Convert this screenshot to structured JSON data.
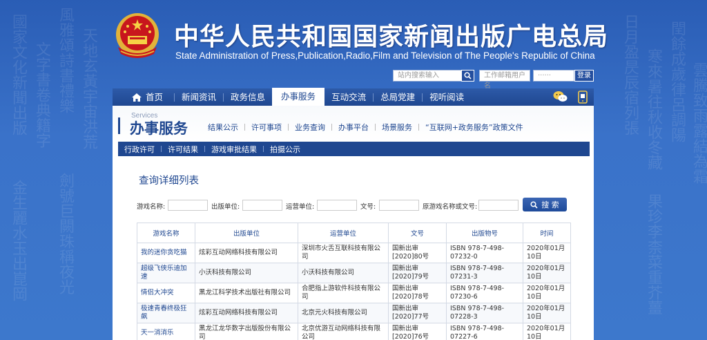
{
  "header": {
    "title_cn": "中华人民共和国国家新闻出版广电总局",
    "title_en": "State Administration of Press,Publication,Radio,Film and Television of The People's Republic of China",
    "search_placeholder": "站内搜索输入",
    "mail_placeholder": "工作邮箱用户名",
    "password_mask": "······",
    "login_label": "登录"
  },
  "nav": {
    "items": [
      {
        "label": "首页"
      },
      {
        "label": "新闻资讯"
      },
      {
        "label": "政务信息"
      },
      {
        "label": "办事服务"
      },
      {
        "label": "互动交流"
      },
      {
        "label": "总局党建"
      },
      {
        "label": "视听阅读"
      }
    ],
    "active": "办事服务"
  },
  "section": {
    "title_en": "Services",
    "title_cn": "办事服务",
    "links": [
      {
        "label": "结果公示"
      },
      {
        "label": "许可事项"
      },
      {
        "label": "业务查询"
      },
      {
        "label": "办事平台"
      },
      {
        "label": "场景服务"
      },
      {
        "label": "“互联网+政务服务”政策文件"
      }
    ],
    "subnav": [
      {
        "label": "行政许可"
      },
      {
        "label": "许可结果"
      },
      {
        "label": "游戏审批结果"
      },
      {
        "label": "拍摄公示"
      }
    ]
  },
  "query": {
    "title": "查询详细列表",
    "filters": [
      {
        "label": "游戏名称:"
      },
      {
        "label": "出版单位:"
      },
      {
        "label": "运营单位:"
      },
      {
        "label": "文号:"
      },
      {
        "label": "原游戏名称或文号:"
      }
    ],
    "search_button": "搜 索"
  },
  "table": {
    "headers": [
      "游戏名称",
      "出版单位",
      "运营单位",
      "文号",
      "出版物号",
      "时间"
    ],
    "rows": [
      [
        "我的迷你贪吃猫",
        "炫彩互动网络科技有限公司",
        "深圳市火舌互联科技有限公司",
        "国新出审[2020]80号",
        "ISBN 978-7-498-07232-0",
        "2020年01月10日"
      ],
      [
        "超级飞侠乐迪加速",
        "小沃科技有限公司",
        "小沃科技有限公司",
        "国新出审[2020]79号",
        "ISBN 978-7-498-07231-3",
        "2020年01月10日"
      ],
      [
        "情侣大冲突",
        "黑龙江科学技术出版社有限公司",
        "合肥指上游软件科技有限公司",
        "国新出审[2020]78号",
        "ISBN 978-7-498-07230-6",
        "2020年01月10日"
      ],
      [
        "极速青春终极狂飙",
        "炫彩互动网络科技有限公司",
        "北京元火科技有限公司",
        "国新出审[2020]77号",
        "ISBN 978-7-498-07228-3",
        "2020年01月10日"
      ],
      [
        "天一消消乐",
        "黑龙江龙华数字出版股份有限公司",
        "北京优游互动网络科技有限公司",
        "国新出审[2020]76号",
        "ISBN 978-7-498-07227-6",
        "2020年01月10日"
      ]
    ]
  }
}
